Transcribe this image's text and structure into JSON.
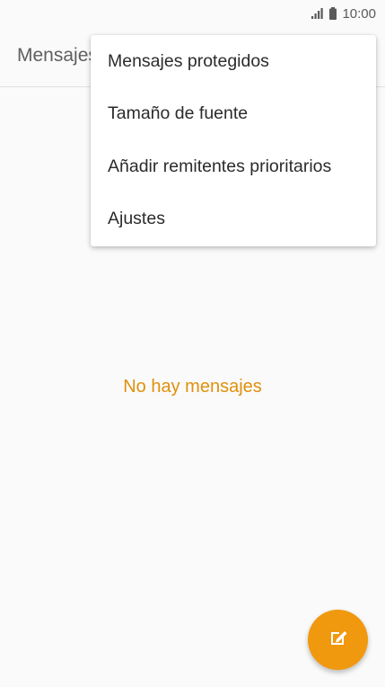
{
  "status_bar": {
    "time": "10:00",
    "icons": [
      "signal-icon",
      "battery-icon"
    ]
  },
  "app_bar": {
    "title": "Mensajes"
  },
  "overflow_menu": {
    "items": [
      {
        "label": "Mensajes protegidos"
      },
      {
        "label": "Tamaño de fuente"
      },
      {
        "label": "Añadir remitentes prioritarios"
      },
      {
        "label": "Ajustes"
      }
    ]
  },
  "empty_state": {
    "text": "No hay mensajes"
  },
  "fab": {
    "icon": "compose-icon"
  },
  "colors": {
    "accent": "#f0990f",
    "empty_text": "#e0900c",
    "background": "#fafafa"
  }
}
